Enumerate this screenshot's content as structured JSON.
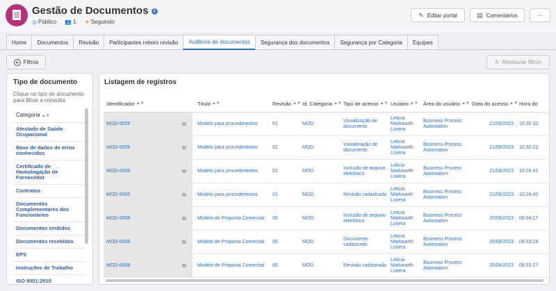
{
  "header": {
    "title": "Gestão de Documentos",
    "visibility": "Público",
    "members": "1",
    "following": "Seguindo",
    "edit_label": "Editar portal",
    "comments_label": "Comentários",
    "more_label": "···"
  },
  "tabs": [
    "Home",
    "Documentos",
    "Revisão",
    "Participantes roteiro revisão",
    "Auditoria de documentos",
    "Segurança dos documentos",
    "Segurança por Categoria",
    "Equipes"
  ],
  "active_tab": "Auditoria de documentos",
  "toolbar": {
    "filters_label": "Filtros",
    "restore_label": "Restaurar filtros"
  },
  "left_panel": {
    "title": "Tipo de documento",
    "hint": "Clique no tipo de documento para filtrar a consulta",
    "category_header": "Categoria",
    "items": [
      "Atestado de Saúde Ocupacional",
      "Base de dados de erros conhecidos",
      "Certificado de Homologação de Fornecedor",
      "Contratos",
      "Documentos Complementares dos Funcionários",
      "Documentos emitidos",
      "Documentos recebidos",
      "EPS",
      "Instruções de Trabalho",
      "ISO 9001:2015"
    ]
  },
  "table": {
    "title": "Listagem de registros",
    "columns": [
      "Identificador",
      "Título",
      "Revisão",
      "Id. Categoria",
      "Tipo de acesso",
      "Usuário",
      "Área do usuário",
      "Data do acesso",
      "Hora do"
    ],
    "rows": [
      [
        "MOD-0005",
        "Modelo para procedimentos",
        "01",
        "MOD",
        "Visualização de documento",
        "Leticia Markwarth Lovera",
        "Business Process Automation",
        "21/09/2023",
        "10:30:32"
      ],
      [
        "MOD-0005",
        "Modelo para procedimentos",
        "01",
        "MOD",
        "Visualização de documento",
        "Leticia Markwarth Lovera",
        "Business Process Automation",
        "21/09/2023",
        "10:30:22"
      ],
      [
        "MOD-0005",
        "Modelo para procedimentos",
        "01",
        "MOD",
        "Inclusão de arquivo eletrônico",
        "Leticia Markwarth Lovera",
        "Business Process Automation",
        "21/09/2023",
        "10:26:41"
      ],
      [
        "MOD-0005",
        "Modelo para procedimentos",
        "01",
        "MOD",
        "Revisão cadastrada",
        "Leticia Markwarth Lovera",
        "Business Process Automation",
        "21/09/2023",
        "10:26:40"
      ],
      [
        "MOD-0008",
        "Modelo de Proposta Comercial",
        "00",
        "MOD",
        "Inclusão de arquivo eletrônico",
        "Leticia Markwarth Lovera",
        "Business Process Automation",
        "20/09/2023",
        "08:34:17"
      ],
      [
        "MOD-0008",
        "Modelo de Proposta Comercial",
        "00",
        "MOD",
        "Documento cadastrado",
        "Leticia Markwarth Lovera",
        "Business Process Automation",
        "20/09/2023",
        "08:33:28"
      ],
      [
        "MOD-0008",
        "Modelo de Proposta Comercial",
        "00",
        "MOD",
        "Revisão cadastrada",
        "Leticia Markwarth Lovera",
        "Business Process Automation",
        "20/09/2023",
        "08:33:27"
      ]
    ]
  }
}
